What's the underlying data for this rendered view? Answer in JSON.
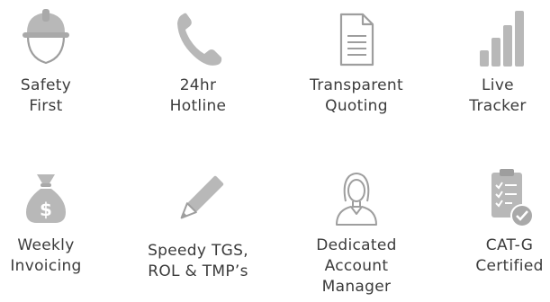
{
  "colors": {
    "icon_fill": "#b8b8b8",
    "icon_stroke": "#9e9e9e",
    "text": "#3b3b3b"
  },
  "features": [
    {
      "icon": "hard-hat-worker-icon",
      "lines": [
        "Safety",
        "First"
      ]
    },
    {
      "icon": "phone-icon",
      "lines": [
        "24hr",
        "Hotline"
      ]
    },
    {
      "icon": "document-icon",
      "lines": [
        "Transparent",
        "Quoting"
      ]
    },
    {
      "icon": "bar-chart-icon",
      "lines": [
        "Live",
        "Tracker"
      ]
    },
    {
      "icon": "money-bag-icon",
      "lines": [
        "Weekly",
        "Invoicing"
      ]
    },
    {
      "icon": "pencil-icon",
      "lines": [
        "Speedy TGS,",
        "ROL & TMP’s"
      ]
    },
    {
      "icon": "account-manager-icon",
      "lines": [
        "Dedicated",
        "Account",
        "Manager"
      ]
    },
    {
      "icon": "certified-checklist-icon",
      "lines": [
        "CAT-G",
        "Certified"
      ]
    }
  ]
}
